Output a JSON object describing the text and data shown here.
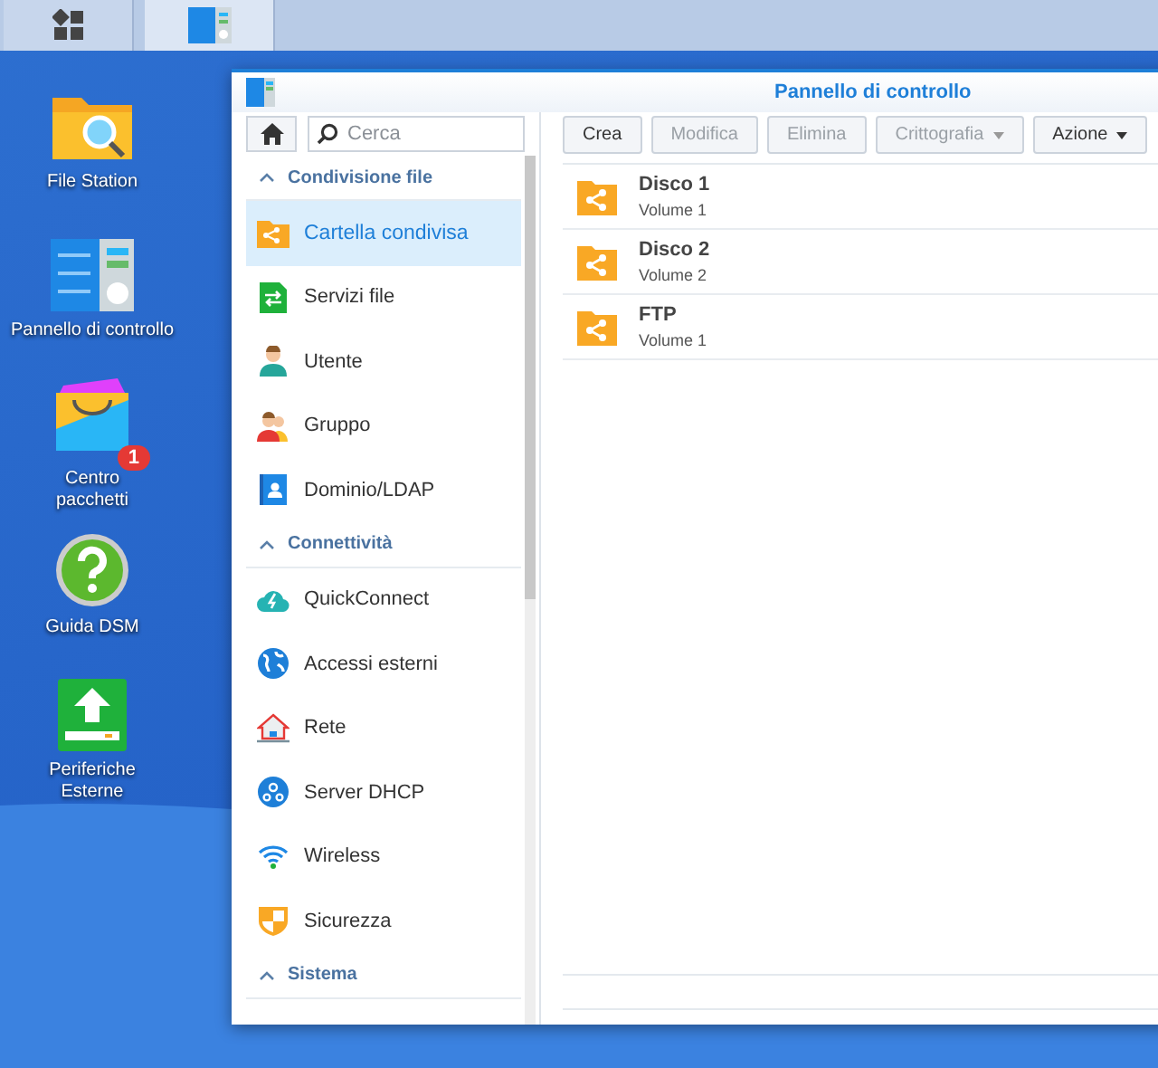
{
  "taskbar": {
    "buttons": [
      {
        "kind": "apps",
        "selected": false
      },
      {
        "kind": "panel",
        "selected": true
      }
    ]
  },
  "desktop_icons": [
    {
      "kind": "filestation",
      "label": "File Station"
    },
    {
      "kind": "panel",
      "label": "Pannello di controllo"
    },
    {
      "kind": "package",
      "label": "Centro pacchetti",
      "badge": "1"
    },
    {
      "kind": "help",
      "label": "Guida DSM"
    },
    {
      "kind": "external",
      "label": "Periferiche Esterne"
    }
  ],
  "window": {
    "title": "Pannello di controllo",
    "sidebar": {
      "search": {
        "placeholder": "Cerca"
      },
      "items": [
        {
          "kind": "header",
          "label": "Condivisione file"
        },
        {
          "kind": "item",
          "label": "Cartella condivisa",
          "selected": true
        },
        {
          "kind": "item",
          "label": "Servizi file",
          "selected": false
        },
        {
          "kind": "item",
          "label": "Utente",
          "selected": false
        },
        {
          "kind": "item",
          "label": "Gruppo",
          "selected": false
        },
        {
          "kind": "item",
          "label": "Dominio/LDAP",
          "selected": false
        },
        {
          "kind": "header",
          "label": "Connettività"
        },
        {
          "kind": "item",
          "label": "QuickConnect",
          "selected": false
        },
        {
          "kind": "item",
          "label": "Accessi esterni",
          "selected": false
        },
        {
          "kind": "item",
          "label": "Rete",
          "selected": false
        },
        {
          "kind": "item",
          "label": "Server DHCP",
          "selected": false
        },
        {
          "kind": "item",
          "label": "Wireless",
          "selected": false
        },
        {
          "kind": "item",
          "label": "Sicurezza",
          "selected": false
        },
        {
          "kind": "header",
          "label": "Sistema"
        }
      ]
    },
    "toolbar": [
      {
        "label": "Crea",
        "disabled": false,
        "menu": false
      },
      {
        "label": "Modifica",
        "disabled": true,
        "menu": false
      },
      {
        "label": "Elimina",
        "disabled": true,
        "menu": false
      },
      {
        "label": "Crittografia",
        "disabled": true,
        "menu": true
      },
      {
        "label": "Azione",
        "disabled": false,
        "menu": true
      }
    ],
    "folders": [
      {
        "name": "Disco 1",
        "volume": "Volume 1"
      },
      {
        "name": "Disco 2",
        "volume": "Volume 2"
      },
      {
        "name": "FTP",
        "volume": "Volume 1"
      }
    ]
  }
}
